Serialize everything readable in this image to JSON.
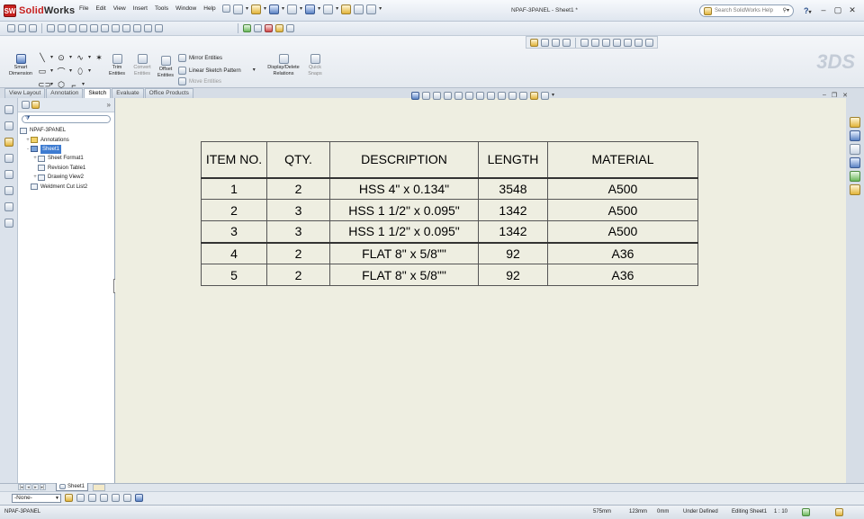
{
  "app": {
    "logo_letters": "SW",
    "logo_solid": "Solid",
    "logo_works": "Works",
    "menu": [
      "File",
      "Edit",
      "View",
      "Insert",
      "Tools",
      "Window",
      "Help"
    ],
    "document_title": "NPAF-3PANEL - Sheet1 *",
    "search_placeholder": "Search SolidWorks Help",
    "help_label": "?"
  },
  "ribbon": {
    "smart_dimension": "Smart Dimension",
    "trim_entities": "Trim Entities",
    "convert_entities": "Convert Entities",
    "offset_entities": "Offset Entities",
    "mirror_entities": "Mirror Entities",
    "linear_sketch_pattern": "Linear Sketch Pattern",
    "move_entities": "Move Entities",
    "display_delete_relations": "Display/Delete Relations",
    "quick_snaps": "Quick Snaps",
    "brand_mark": "3DS"
  },
  "command_tabs": [
    {
      "label": "View Layout",
      "active": false
    },
    {
      "label": "Annotation",
      "active": false
    },
    {
      "label": "Sketch",
      "active": true
    },
    {
      "label": "Evaluate",
      "active": false
    },
    {
      "label": "Office Products",
      "active": false
    }
  ],
  "feature_tree": {
    "root": "NPAF-3PANEL",
    "nodes": [
      {
        "label": "Annotations",
        "depth": 1,
        "expander": "+"
      },
      {
        "label": "Sheet1",
        "depth": 1,
        "expander": "-",
        "selected": true
      },
      {
        "label": "Sheet Format1",
        "depth": 2,
        "expander": "+"
      },
      {
        "label": "Revision Table1",
        "depth": 2,
        "expander": ""
      },
      {
        "label": "Drawing View2",
        "depth": 2,
        "expander": "+"
      },
      {
        "label": "Weldment Cut List2",
        "depth": 1,
        "expander": ""
      }
    ],
    "collapse_label": "»"
  },
  "bom_table": {
    "headers": [
      "ITEM NO.",
      "QTY.",
      "DESCRIPTION",
      "LENGTH",
      "MATERIAL"
    ],
    "rows": [
      [
        "1",
        "2",
        "HSS 4\" x 0.134\"",
        "3548",
        "A500"
      ],
      [
        "2",
        "3",
        "HSS 1 1/2\" x 0.095\"",
        "1342",
        "A500"
      ],
      [
        "3",
        "3",
        "HSS 1 1/2\" x 0.095\"",
        "1342",
        "A500"
      ],
      [
        "4",
        "2",
        "FLAT 8\" x 5/8\"\"",
        "92",
        "A36"
      ],
      [
        "5",
        "2",
        "FLAT 8\" x 5/8\"\"",
        "92",
        "A36"
      ]
    ]
  },
  "sheets": {
    "active_tab": "Sheet1"
  },
  "layer": {
    "current": "-None-"
  },
  "status": {
    "file_name": "NPAF-3PANEL",
    "x": "575mm",
    "y": "123mm",
    "z": "0mm",
    "state": "Under Defined",
    "mode": "Editing Sheet1",
    "scale": "1 : 10"
  }
}
